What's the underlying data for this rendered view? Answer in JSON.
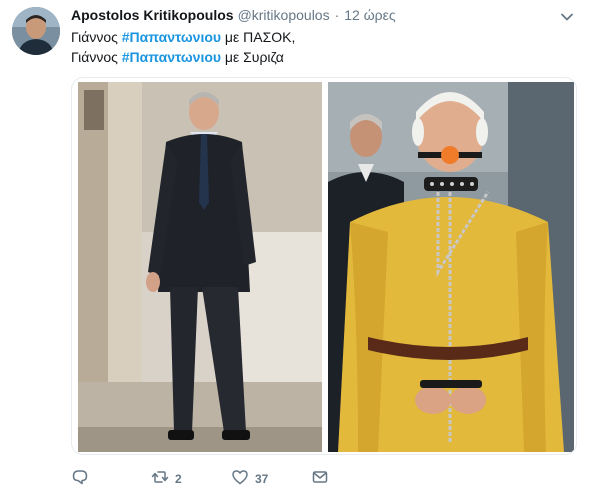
{
  "tweet": {
    "author_name": "Apostolos Kritikopoulos",
    "handle": "@kritikopoulos",
    "separator": "·",
    "timestamp": "12 ώρες",
    "line1": {
      "prefix": "Γιάννος ",
      "hashtag": "#Παπαντωνιου",
      "suffix": " με ΠΑΣΟΚ,"
    },
    "line2": {
      "prefix": "Γιάννος ",
      "hashtag": "#Παπαντωνιου",
      "suffix": " με Συριζα"
    }
  },
  "actions": {
    "reply_count": "",
    "retweet_count": "2",
    "like_count": "37"
  },
  "icons": {
    "reply": "reply-icon",
    "retweet": "retweet-icon",
    "like": "heart-icon",
    "message": "envelope-icon",
    "menu": "chevron-down-icon"
  },
  "colors": {
    "hashtag": "#1b95e0",
    "muted": "#657786",
    "text": "#14171a"
  }
}
